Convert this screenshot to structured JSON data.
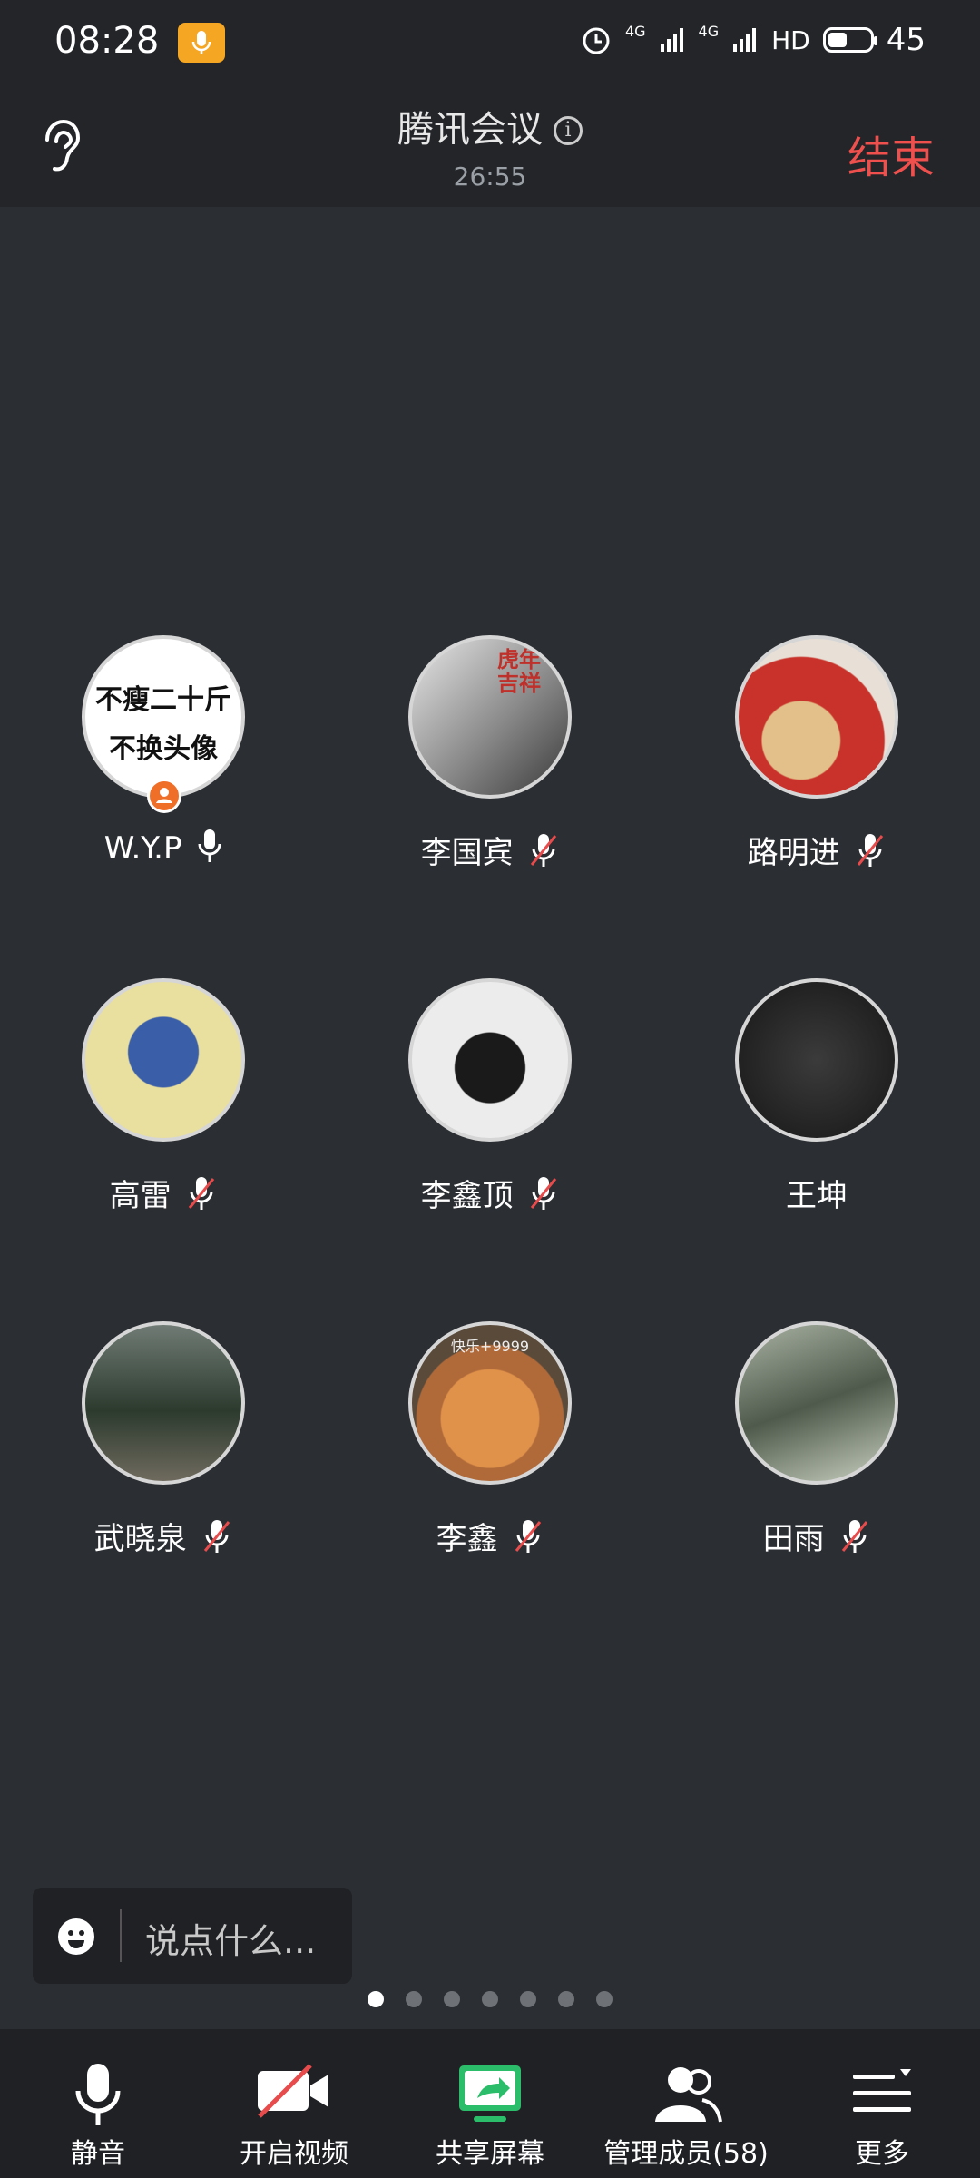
{
  "status_bar": {
    "time": "08:28",
    "network": "4G",
    "network2": "4G",
    "hd": "HD",
    "battery": "45"
  },
  "header": {
    "title": "腾讯会议",
    "duration": "26:55",
    "end_label": "结束"
  },
  "participants": [
    {
      "name": "W.Y.P",
      "mic": "on",
      "avatar_text_1": "不瘦二十斤",
      "avatar_text_2": "不换头像",
      "host": true
    },
    {
      "name": "李国宾",
      "mic": "muted",
      "avatar_text_1": "虎年吉祥"
    },
    {
      "name": "路明进",
      "mic": "muted"
    },
    {
      "name": "高雷",
      "mic": "muted"
    },
    {
      "name": "李鑫顶",
      "mic": "muted"
    },
    {
      "name": "王坤",
      "mic": "none"
    },
    {
      "name": "武晓泉",
      "mic": "muted"
    },
    {
      "name": "李鑫",
      "mic": "muted",
      "avatar_text_1": "快乐+9999"
    },
    {
      "name": "田雨",
      "mic": "muted"
    }
  ],
  "chat": {
    "placeholder": "说点什么..."
  },
  "pager": {
    "pages": 7,
    "current": 1
  },
  "toolbar": {
    "mute_label": "静音",
    "video_label": "开启视频",
    "share_label": "共享屏幕",
    "members_label": "管理成员(58)",
    "more_label": "更多"
  },
  "colors": {
    "end": "#f0504d",
    "share": "#2bbd6a",
    "host_badge": "#f06f28"
  }
}
